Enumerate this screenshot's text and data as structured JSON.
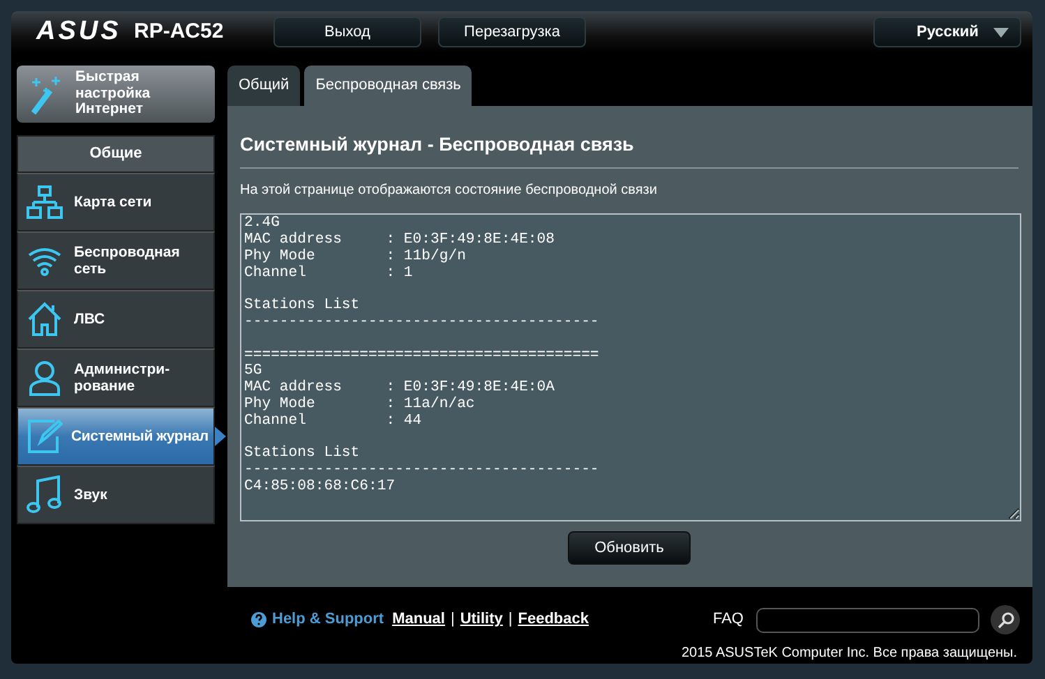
{
  "header": {
    "logo": "ASUS",
    "model": "RP-AC52",
    "buttons": [
      "Выход",
      "Перезагрузка"
    ],
    "language": "Русский"
  },
  "sidebar": {
    "quick_setup": "Быстрая настройка Интернет",
    "section": "Общие",
    "items": [
      {
        "label": "Карта сети",
        "kind": "network",
        "selected": false
      },
      {
        "label": "Беспроводная сеть",
        "kind": "wifi",
        "selected": false
      },
      {
        "label": "ЛВС",
        "kind": "home",
        "selected": false
      },
      {
        "label": "Администри-рование",
        "kind": "admin",
        "selected": false
      },
      {
        "label": "Системный журнал",
        "kind": "log",
        "selected": true
      },
      {
        "label": "Звук",
        "kind": "music",
        "selected": false
      }
    ]
  },
  "tabs": [
    {
      "label": "Общий",
      "selected": false
    },
    {
      "label": "Беспроводная связь",
      "selected": true
    }
  ],
  "title": "Системный журнал - Беспроводная связь",
  "description": "На этой странице отображаются состояние беспроводной связи",
  "log": [
    [
      "2.4G",
      "MAC address     : E0:3F:49:8E:4E:08",
      "Phy Mode        : 11b/g/n",
      "Channel         : 1"
    ],
    [
      "Stations List",
      "----------------------------------------"
    ],
    [
      "========================================",
      "5G",
      "MAC address     : E0:3F:49:8E:4E:0A",
      "Phy Mode        : 11a/n/ac",
      "Channel         : 44"
    ],
    [
      "Stations List",
      "----------------------------------------",
      "C4:85:08:68:C6:17"
    ]
  ],
  "refresh_button": "Обновить",
  "footer": {
    "help": "Help & Support",
    "links": [
      "Manual",
      "Utility",
      "Feedback"
    ],
    "separators": [
      "|",
      "|"
    ],
    "faq_label": "FAQ",
    "copyright": "2015 ASUSTeK Computer Inc. Все права защищены."
  }
}
